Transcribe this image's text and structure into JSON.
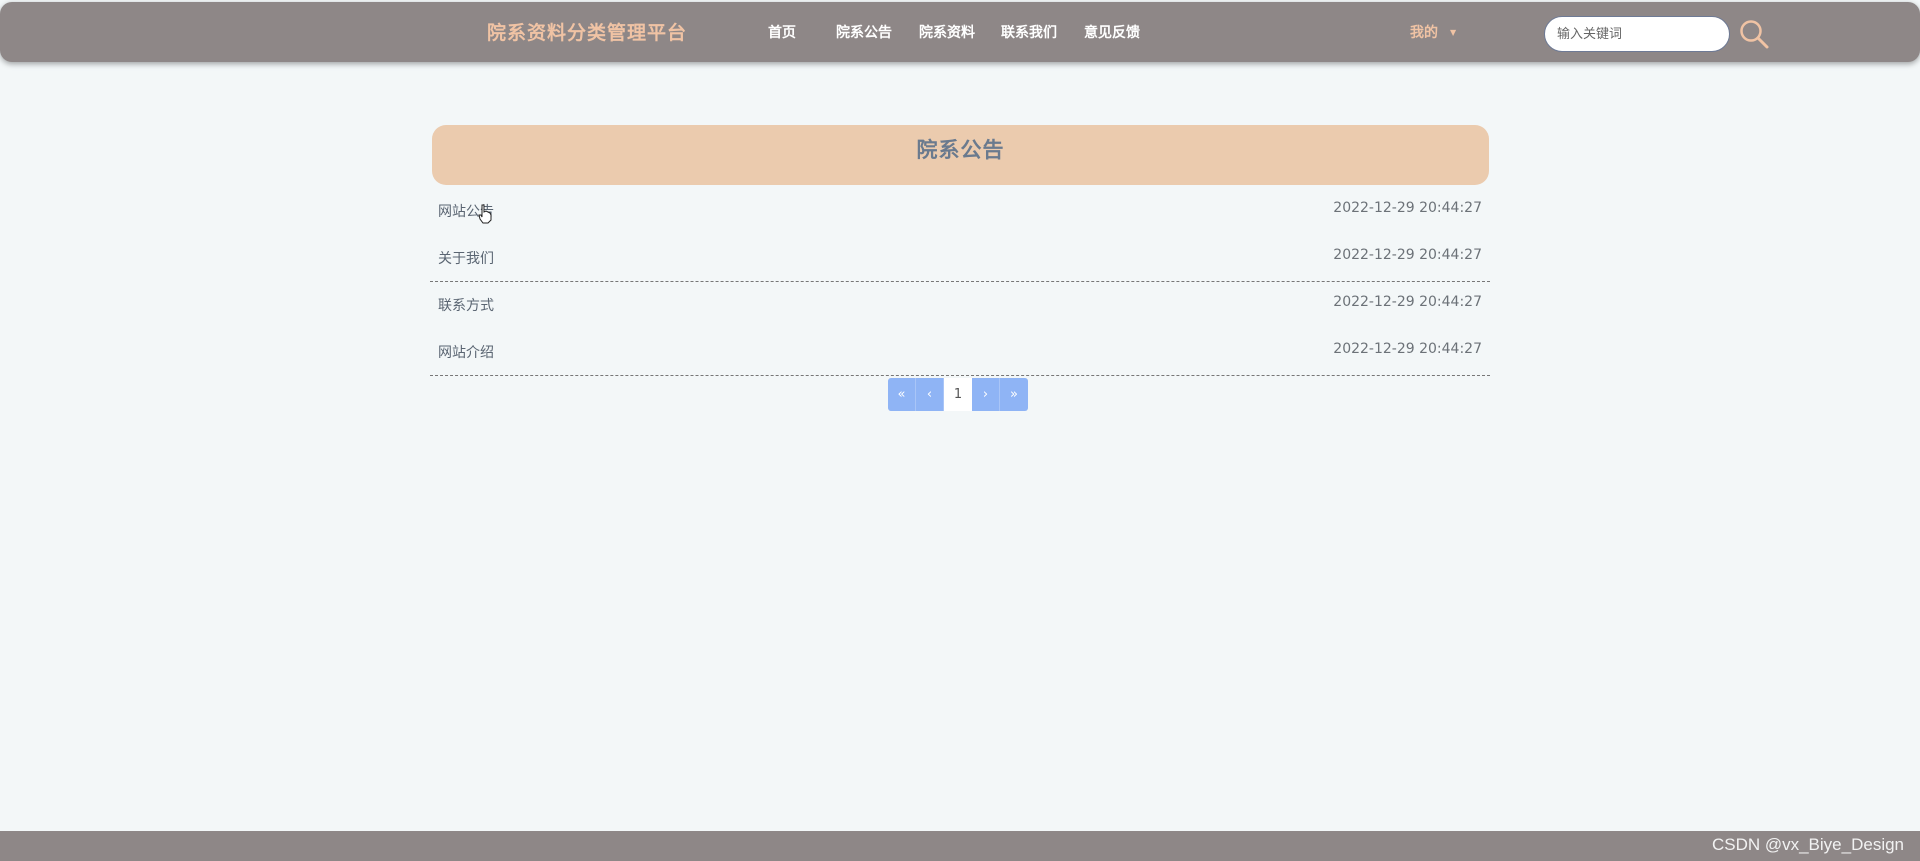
{
  "header": {
    "brand": "院系资料分类管理平台",
    "nav": [
      {
        "label": "首页"
      },
      {
        "label": "院系公告"
      },
      {
        "label": "院系资料"
      },
      {
        "label": "联系我们"
      },
      {
        "label": "意见反馈"
      }
    ],
    "mine_label": "我的",
    "search_placeholder": "输入关键词"
  },
  "main": {
    "section_title": "院系公告",
    "notices": [
      {
        "title": "网站公告",
        "date": "2022-12-29 20:44:27"
      },
      {
        "title": "关于我们",
        "date": "2022-12-29 20:44:27"
      },
      {
        "title": "联系方式",
        "date": "2022-12-29 20:44:27"
      },
      {
        "title": "网站介绍",
        "date": "2022-12-29 20:44:27"
      }
    ],
    "pager": {
      "first": "«",
      "prev": "‹",
      "current": "1",
      "next": "›",
      "last": "»"
    }
  },
  "footer": {
    "watermark": "CSDN @vx_Biye_Design"
  },
  "colors": {
    "header_bg": "#8e8787",
    "brand": "#f0c3a4",
    "title_bg": "#ebcbae",
    "pager_bg": "#8fb4f5"
  },
  "icons": {
    "search": "search-icon",
    "caret": "caret-down-icon",
    "cursor": "hand-cursor-icon"
  }
}
